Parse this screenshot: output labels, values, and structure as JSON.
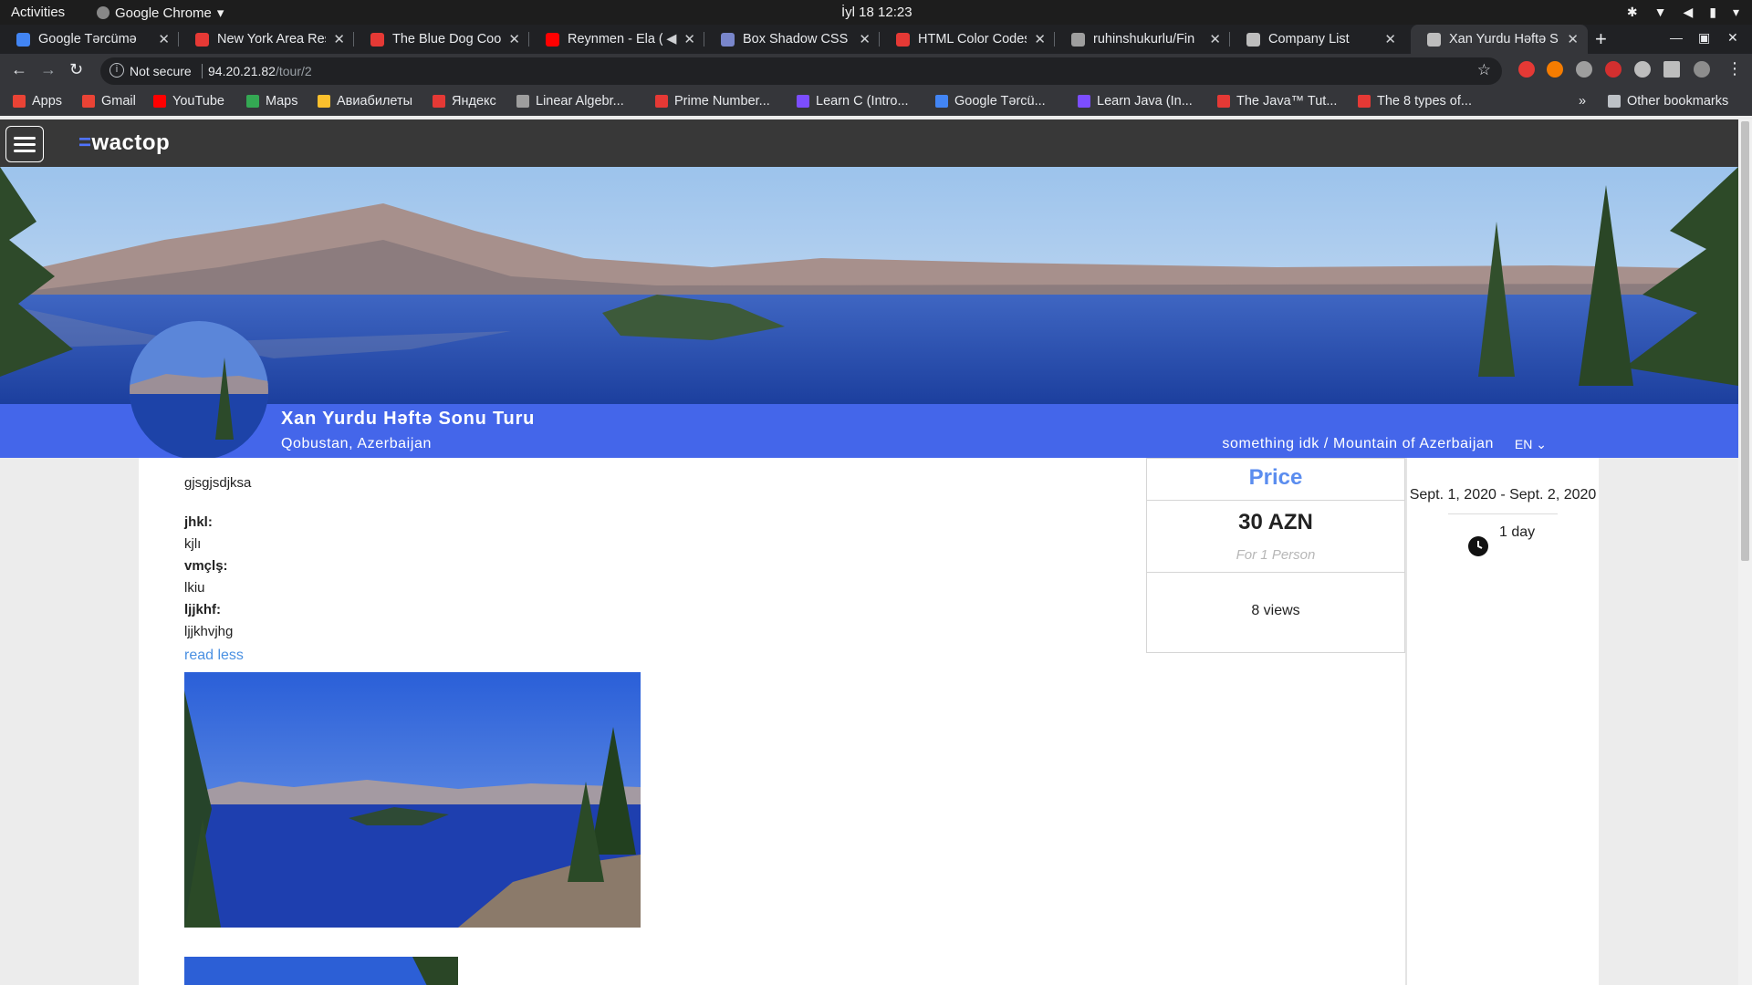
{
  "os": {
    "activities": "Activities",
    "app_name": "Google Chrome",
    "clock": "İyl 18  12:23"
  },
  "browser": {
    "tabs": [
      {
        "title": "Google Tərcümə",
        "color": "#4285f4"
      },
      {
        "title": "New York Area Res",
        "color": "#e53935"
      },
      {
        "title": "The Blue Dog Cook",
        "color": "#e53935"
      },
      {
        "title": "Reynmen - Ela (",
        "color": "#ff0000"
      },
      {
        "title": "Box Shadow CSS G",
        "color": "#7986cb"
      },
      {
        "title": "HTML Color Codes",
        "color": "#e53935"
      },
      {
        "title": "ruhinshukurlu/Fin",
        "color": "#9e9e9e"
      },
      {
        "title": "Company List",
        "color": "#bdbdbd"
      },
      {
        "title": "Xan Yurdu Həftə S",
        "color": "#bdbdbd"
      }
    ],
    "url_security": "Not secure",
    "url_host": "94.20.21.82",
    "url_path": "/tour/2",
    "bookmarks": [
      {
        "label": "Apps",
        "color": "#ea4335"
      },
      {
        "label": "Gmail",
        "color": "#ea4335"
      },
      {
        "label": "YouTube",
        "color": "#ff0000"
      },
      {
        "label": "Maps",
        "color": "#34a853"
      },
      {
        "label": "Авиабилеты",
        "color": "#fbc02d"
      },
      {
        "label": "Яндекс",
        "color": "#e53935"
      },
      {
        "label": "Linear Algebr...",
        "color": "#9e9e9e"
      },
      {
        "label": "Prime Number...",
        "color": "#e53935"
      },
      {
        "label": "Learn C (Intro...",
        "color": "#7c4dff"
      },
      {
        "label": "Google Tərcü...",
        "color": "#4285f4"
      },
      {
        "label": "Learn Java (In...",
        "color": "#7c4dff"
      },
      {
        "label": "The Java™ Tut...",
        "color": "#e53935"
      },
      {
        "label": "The 8 types of...",
        "color": "#e53935"
      }
    ],
    "other_bookmarks": "Other bookmarks"
  },
  "site": {
    "logo_text": "wactop",
    "tour": {
      "title": "Xan Yurdu Həftə Sonu Turu",
      "location": "Qobustan, Azerbaijan",
      "breadcrumb": "something idk / Mountain of Azerbaijan",
      "language": "EN"
    },
    "description": {
      "intro": "gjsgjsdjksa",
      "items": [
        {
          "key": "jhkl:",
          "value": "kjlı"
        },
        {
          "key": "vmçlş:",
          "value": "lkiu"
        },
        {
          "key": "ljjkhf:",
          "value": "ljjkhvjhg"
        }
      ],
      "read_less": "read less"
    },
    "price": {
      "label": "Price",
      "amount": "30 AZN",
      "unit": "For 1 Person",
      "views": "8 views"
    },
    "dates": "Sept. 1, 2020 - Sept. 2, 2020",
    "duration": "1 day",
    "accent_color": "#4466ea"
  }
}
